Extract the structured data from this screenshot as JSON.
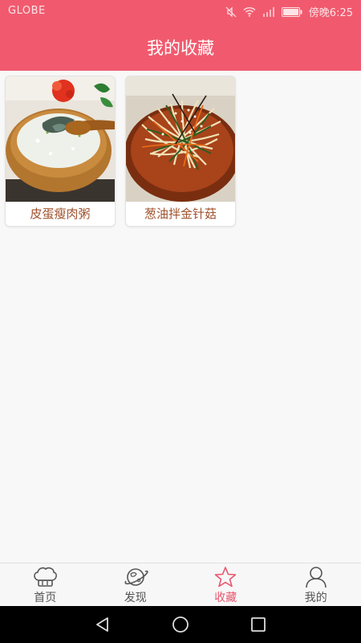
{
  "status_bar": {
    "carrier": "GLOBE",
    "time": "傍晚6:25",
    "icons": [
      "mute-icon",
      "wifi-icon",
      "signal-icon",
      "battery-icon"
    ]
  },
  "header": {
    "title": "我的收藏"
  },
  "favorites": [
    {
      "name": "皮蛋瘦肉粥",
      "image": "congee-photo"
    },
    {
      "name": "葱油拌金针菇",
      "image": "enoki-mushroom-salad-photo"
    }
  ],
  "tabbar": {
    "tabs": [
      {
        "label": "首页",
        "icon": "chef-hat-icon",
        "active": false
      },
      {
        "label": "发现",
        "icon": "planet-icon",
        "active": false
      },
      {
        "label": "收藏",
        "icon": "star-icon",
        "active": true
      },
      {
        "label": "我的",
        "icon": "person-icon",
        "active": false
      }
    ]
  },
  "colors": {
    "brand": "#f15a6e",
    "active_tab": "#e8566c",
    "card_text": "#a0522d"
  },
  "system_nav": {
    "icons": [
      "back-icon",
      "home-icon",
      "recents-icon"
    ]
  }
}
